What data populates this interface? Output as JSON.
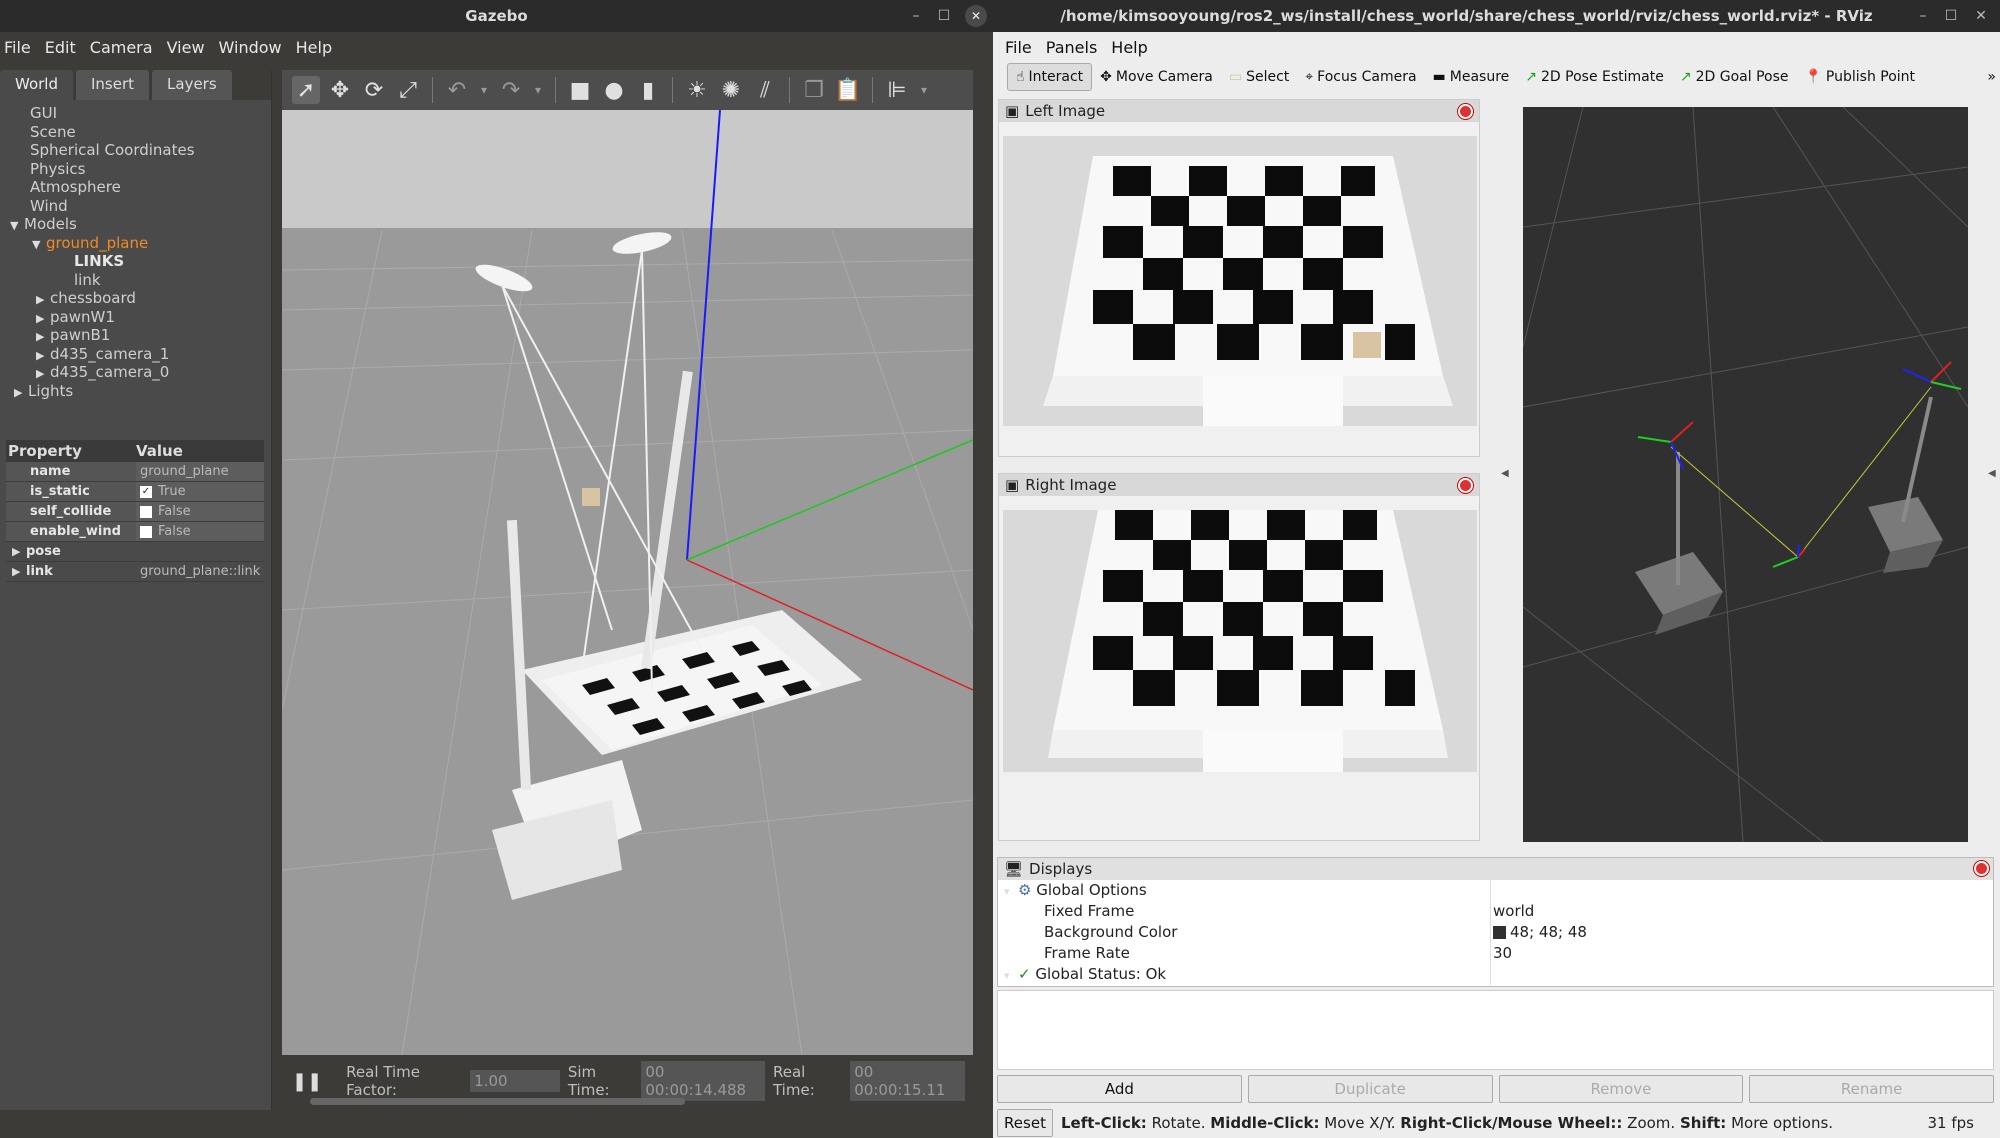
{
  "gazebo": {
    "title": "Gazebo",
    "menu": [
      "File",
      "Edit",
      "Camera",
      "View",
      "Window",
      "Help"
    ],
    "tabs": [
      "World",
      "Insert",
      "Layers"
    ],
    "tree": {
      "gui": "GUI",
      "scene": "Scene",
      "spherical": "Spherical Coordinates",
      "physics": "Physics",
      "atmosphere": "Atmosphere",
      "wind": "Wind",
      "models": "Models",
      "ground_plane": "ground_plane",
      "links_hdr": "LINKS",
      "link": "link",
      "chessboard": "chessboard",
      "pawnW1": "pawnW1",
      "pawnB1": "pawnB1",
      "cam1": "d435_camera_1",
      "cam0": "d435_camera_0",
      "lights": "Lights"
    },
    "props": {
      "hdr_property": "Property",
      "hdr_value": "Value",
      "name_k": "name",
      "name_v": "ground_plane",
      "static_k": "is_static",
      "static_v": "True",
      "collide_k": "self_collide",
      "collide_v": "False",
      "wind_k": "enable_wind",
      "wind_v": "False",
      "pose_k": "pose",
      "link_k": "link",
      "link_v": "ground_plane::link"
    },
    "status": {
      "rtf_label": "Real Time Factor:",
      "rtf": "1.00",
      "sim_label": "Sim Time:",
      "sim": "00 00:00:14.488",
      "real_label": "Real Time:",
      "real": "00 00:00:15.11"
    }
  },
  "rviz": {
    "title": "/home/kimsooyoung/ros2_ws/install/chess_world/share/chess_world/rviz/chess_world.rviz* - RViz",
    "menu": [
      "File",
      "Panels",
      "Help"
    ],
    "tools": [
      "Interact",
      "Move Camera",
      "Select",
      "Focus Camera",
      "Measure",
      "2D Pose Estimate",
      "2D Goal Pose",
      "Publish Point"
    ],
    "left_image": "Left Image",
    "right_image": "Right Image",
    "displays": {
      "title": "Displays",
      "global_options": "Global Options",
      "fixed_frame_k": "Fixed Frame",
      "fixed_frame_v": "world",
      "bg_k": "Background Color",
      "bg_v": "48; 48; 48",
      "fr_k": "Frame Rate",
      "fr_v": "30",
      "status": "Global Status: Ok"
    },
    "buttons": [
      "Add",
      "Duplicate",
      "Remove",
      "Rename"
    ],
    "status": {
      "reset": "Reset",
      "lc": "Left-Click:",
      "lc_t": "Rotate.",
      "mc": "Middle-Click:",
      "mc_t": "Move X/Y.",
      "rc": "Right-Click/Mouse Wheel::",
      "rc_t": "Zoom.",
      "sh": "Shift:",
      "sh_t": "More options.",
      "fps": "31 fps"
    }
  },
  "colors": {
    "gazebo_selected": "#f08a24",
    "rviz_bg": "#303030"
  }
}
